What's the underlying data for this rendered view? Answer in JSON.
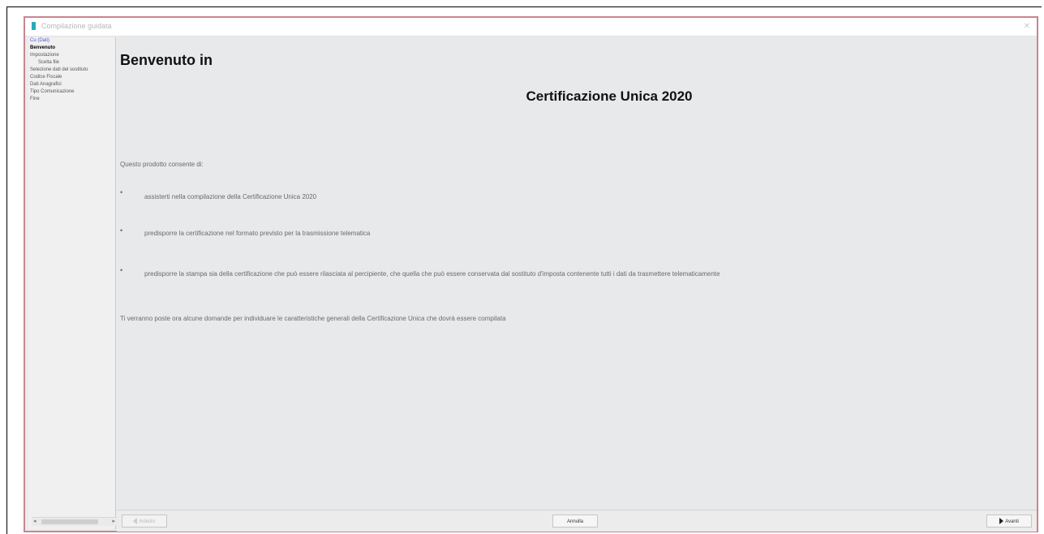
{
  "window": {
    "title": "Compilazione guidata"
  },
  "sidebar": {
    "items": [
      {
        "label": "Cu (Dati)",
        "state": "current",
        "indent": false
      },
      {
        "label": "Benvenuto",
        "state": "active",
        "indent": false
      },
      {
        "label": "Impostazione",
        "state": "normal",
        "indent": false
      },
      {
        "label": "Scelta file",
        "state": "normal",
        "indent": true
      },
      {
        "label": "Selezione dati del sostituto",
        "state": "normal",
        "indent": false
      },
      {
        "label": "Codice Fiscale",
        "state": "normal",
        "indent": false
      },
      {
        "label": "Dati Anagrafici",
        "state": "normal",
        "indent": false
      },
      {
        "label": "Tipo Comunicazione",
        "state": "normal",
        "indent": false
      },
      {
        "label": "Fine",
        "state": "normal",
        "indent": false
      }
    ]
  },
  "main": {
    "title": "Benvenuto in",
    "product": "Certificazione Unica 2020",
    "intro": "Questo prodotto consente di:",
    "bullets": [
      "assisterti nella compilazione della Certificazione Unica 2020",
      "predisporre la certificazione nel formato previsto per la trasmissione telematica",
      "predisporre la stampa sia della certificazione che può essere rilasciata al percipiente, che quella che può essere conservata dal sostituto d'imposta contenente tutti i dati da trasmettere telematicamente"
    ],
    "outro": "Ti verranno poste ora alcune domande per individuare le caratteristiche generali della Certificazione Unica che dovrà essere compilata"
  },
  "buttons": {
    "back": "Indietro",
    "cancel": "Annulla",
    "next": "Avanti"
  }
}
